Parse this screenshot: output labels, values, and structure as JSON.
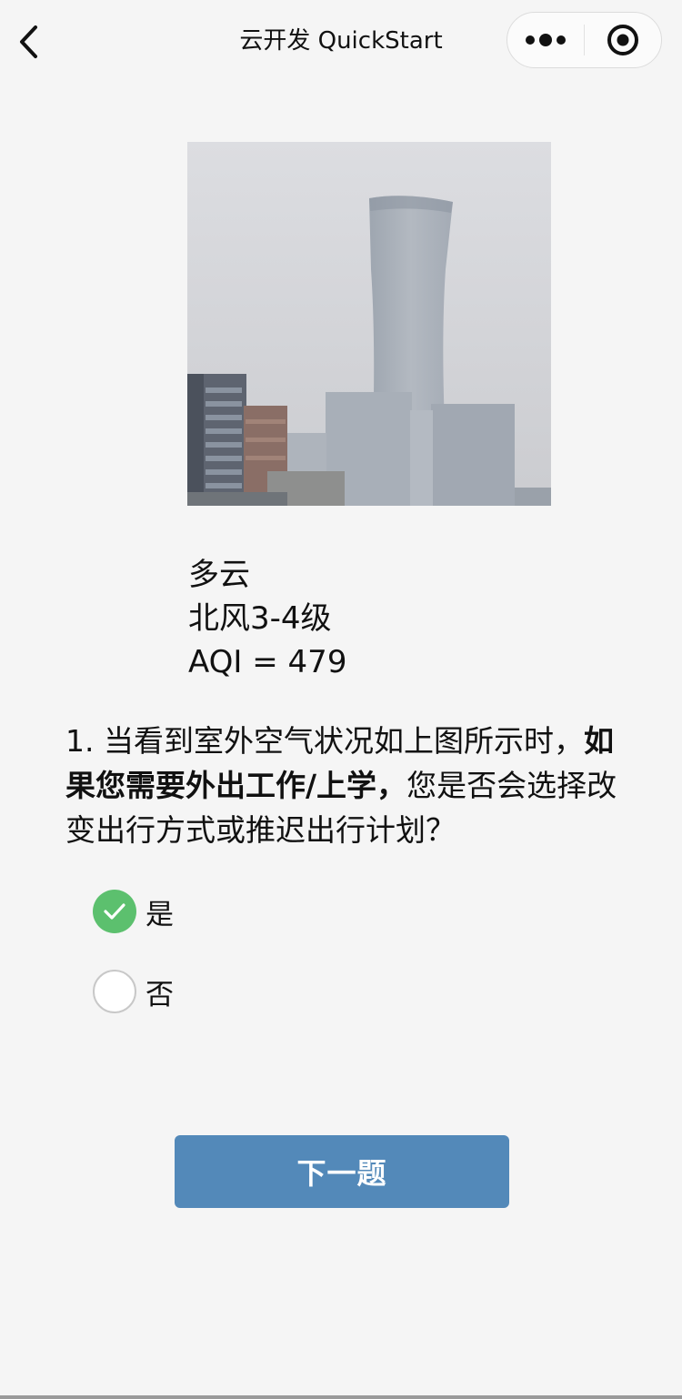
{
  "navbar": {
    "title": "云开发 QuickStart",
    "back_icon": "chevron-left-icon",
    "more_icon": "more-dots-icon",
    "close_icon": "target-circle-icon"
  },
  "weather": {
    "condition": "多云",
    "wind": "北风3-4级",
    "aqi": "AQI = 479"
  },
  "question": {
    "prefix": "1. 当看到室外空气状况如上图所示时，",
    "emphasis": "如果您需要外出工作/上学，",
    "suffix": "您是否会选择改变出行方式或推迟出行计划？"
  },
  "options": [
    {
      "label": "是",
      "checked": true
    },
    {
      "label": "否",
      "checked": false
    }
  ],
  "next_button": {
    "label": "下一题"
  },
  "colors": {
    "accent_green": "#5cc06e",
    "button_blue": "#5389b9",
    "background": "#f5f5f5"
  }
}
